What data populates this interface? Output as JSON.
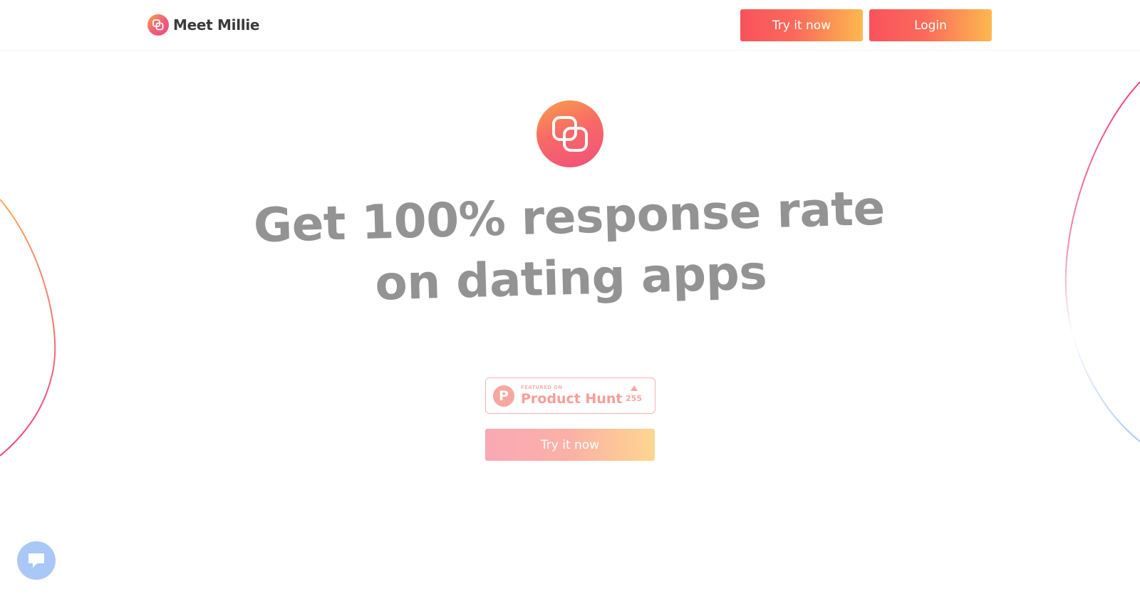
{
  "header": {
    "brand_name": "Meet Millie",
    "try_button_label": "Try it now",
    "login_button_label": "Login"
  },
  "hero": {
    "headline_line1": "Get 100% response rate",
    "headline_line2": "on dating apps",
    "cta_label": "Try it now"
  },
  "product_hunt": {
    "featured_label": "FEATURED ON",
    "name": "Product Hunt",
    "logo_letter": "P",
    "votes": "255"
  },
  "icons": {
    "brand": "overlapping-squares-icon",
    "hero": "overlapping-squares-icon",
    "chat": "chat-bubble-icon",
    "upvote": "upvote-arrow-icon"
  },
  "colors": {
    "button_start": "#f9525b",
    "button_end": "#fdb84e",
    "headline": "#939393",
    "brand_text": "#3a3a3a",
    "chat_bubble": "#a9c8f7"
  }
}
